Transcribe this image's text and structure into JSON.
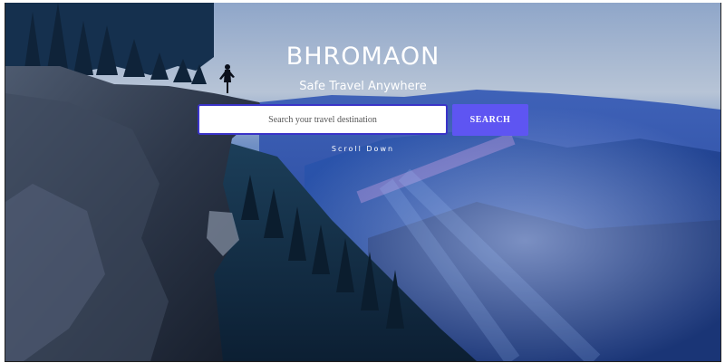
{
  "hero": {
    "brand": "BHROMAON",
    "tagline": "Safe Travel Anywhere",
    "scroll_label": "Scroll Down",
    "background_image": "mountain-cliff-hiker-photo"
  },
  "search": {
    "placeholder": "Search your travel destination",
    "value": "",
    "button_label": "SEARCH"
  },
  "colors": {
    "accent": "#5e55f2",
    "input_border": "#3a33c8",
    "text": "#ffffff"
  }
}
